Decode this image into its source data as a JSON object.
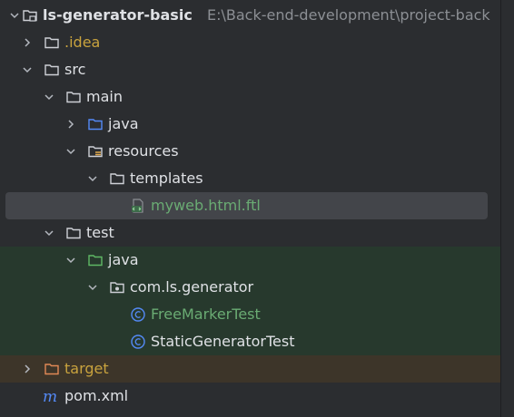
{
  "colors": {
    "default_text": "#dfe1e5",
    "excluded_text": "#c9a33e",
    "test_text": "#6aab73",
    "path_hint": "#8c8f94",
    "selected_bg": "#43454a",
    "test_bg": "#27392d",
    "target_bg": "#3d3529"
  },
  "tree": {
    "project": {
      "label": "ls-generator-basic",
      "path": "E:\\Back-end-development\\project-back",
      "icon": "module-folder-icon"
    },
    "idea": {
      "label": ".idea",
      "icon": "folder-icon"
    },
    "src": {
      "label": "src",
      "icon": "folder-icon"
    },
    "main": {
      "label": "main",
      "icon": "folder-icon"
    },
    "main_java": {
      "label": "java",
      "icon": "source-root-icon"
    },
    "resources": {
      "label": "resources",
      "icon": "resources-root-icon"
    },
    "templates": {
      "label": "templates",
      "icon": "folder-icon"
    },
    "ftl_file": {
      "label": "myweb.html.ftl",
      "icon": "freemarker-file-icon"
    },
    "test": {
      "label": "test",
      "icon": "folder-icon"
    },
    "test_java": {
      "label": "java",
      "icon": "test-root-icon"
    },
    "package": {
      "label": "com.ls.generator",
      "icon": "package-icon"
    },
    "class1": {
      "label": "FreeMarkerTest",
      "icon": "class-icon"
    },
    "class2": {
      "label": "StaticGeneratorTest",
      "icon": "class-icon"
    },
    "target": {
      "label": "target",
      "icon": "excluded-folder-icon"
    },
    "pom": {
      "label": "pom.xml",
      "icon": "maven-icon"
    }
  }
}
